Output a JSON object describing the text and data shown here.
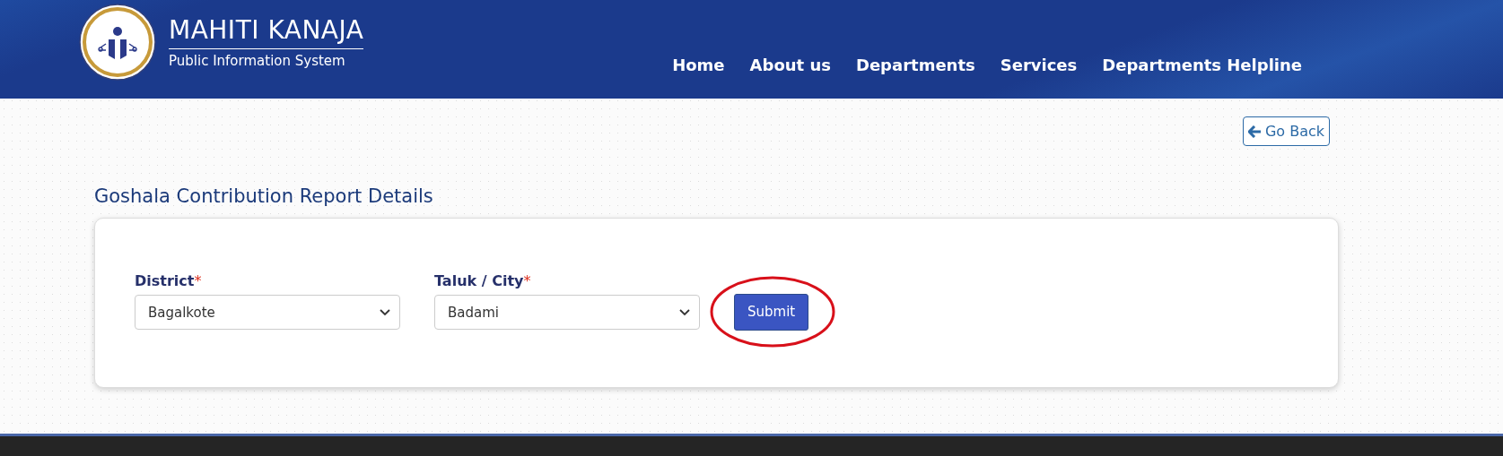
{
  "header": {
    "title": "MAHITI KANAJA",
    "subtitle": "Public Information System"
  },
  "nav": [
    {
      "label": "Home"
    },
    {
      "label": "About us"
    },
    {
      "label": "Departments"
    },
    {
      "label": "Services"
    },
    {
      "label": "Departments Helpline"
    }
  ],
  "go_back": {
    "label": "Go Back"
  },
  "page_title": "Goshala Contribution Report Details",
  "form": {
    "fields": [
      {
        "label": "District",
        "required": true,
        "required_mark": "*",
        "value": "Bagalkote"
      },
      {
        "label": "Taluk / City",
        "required": true,
        "required_mark": "*",
        "value": "Badami"
      }
    ],
    "submit": {
      "label": "Submit",
      "highlighted": true
    }
  }
}
